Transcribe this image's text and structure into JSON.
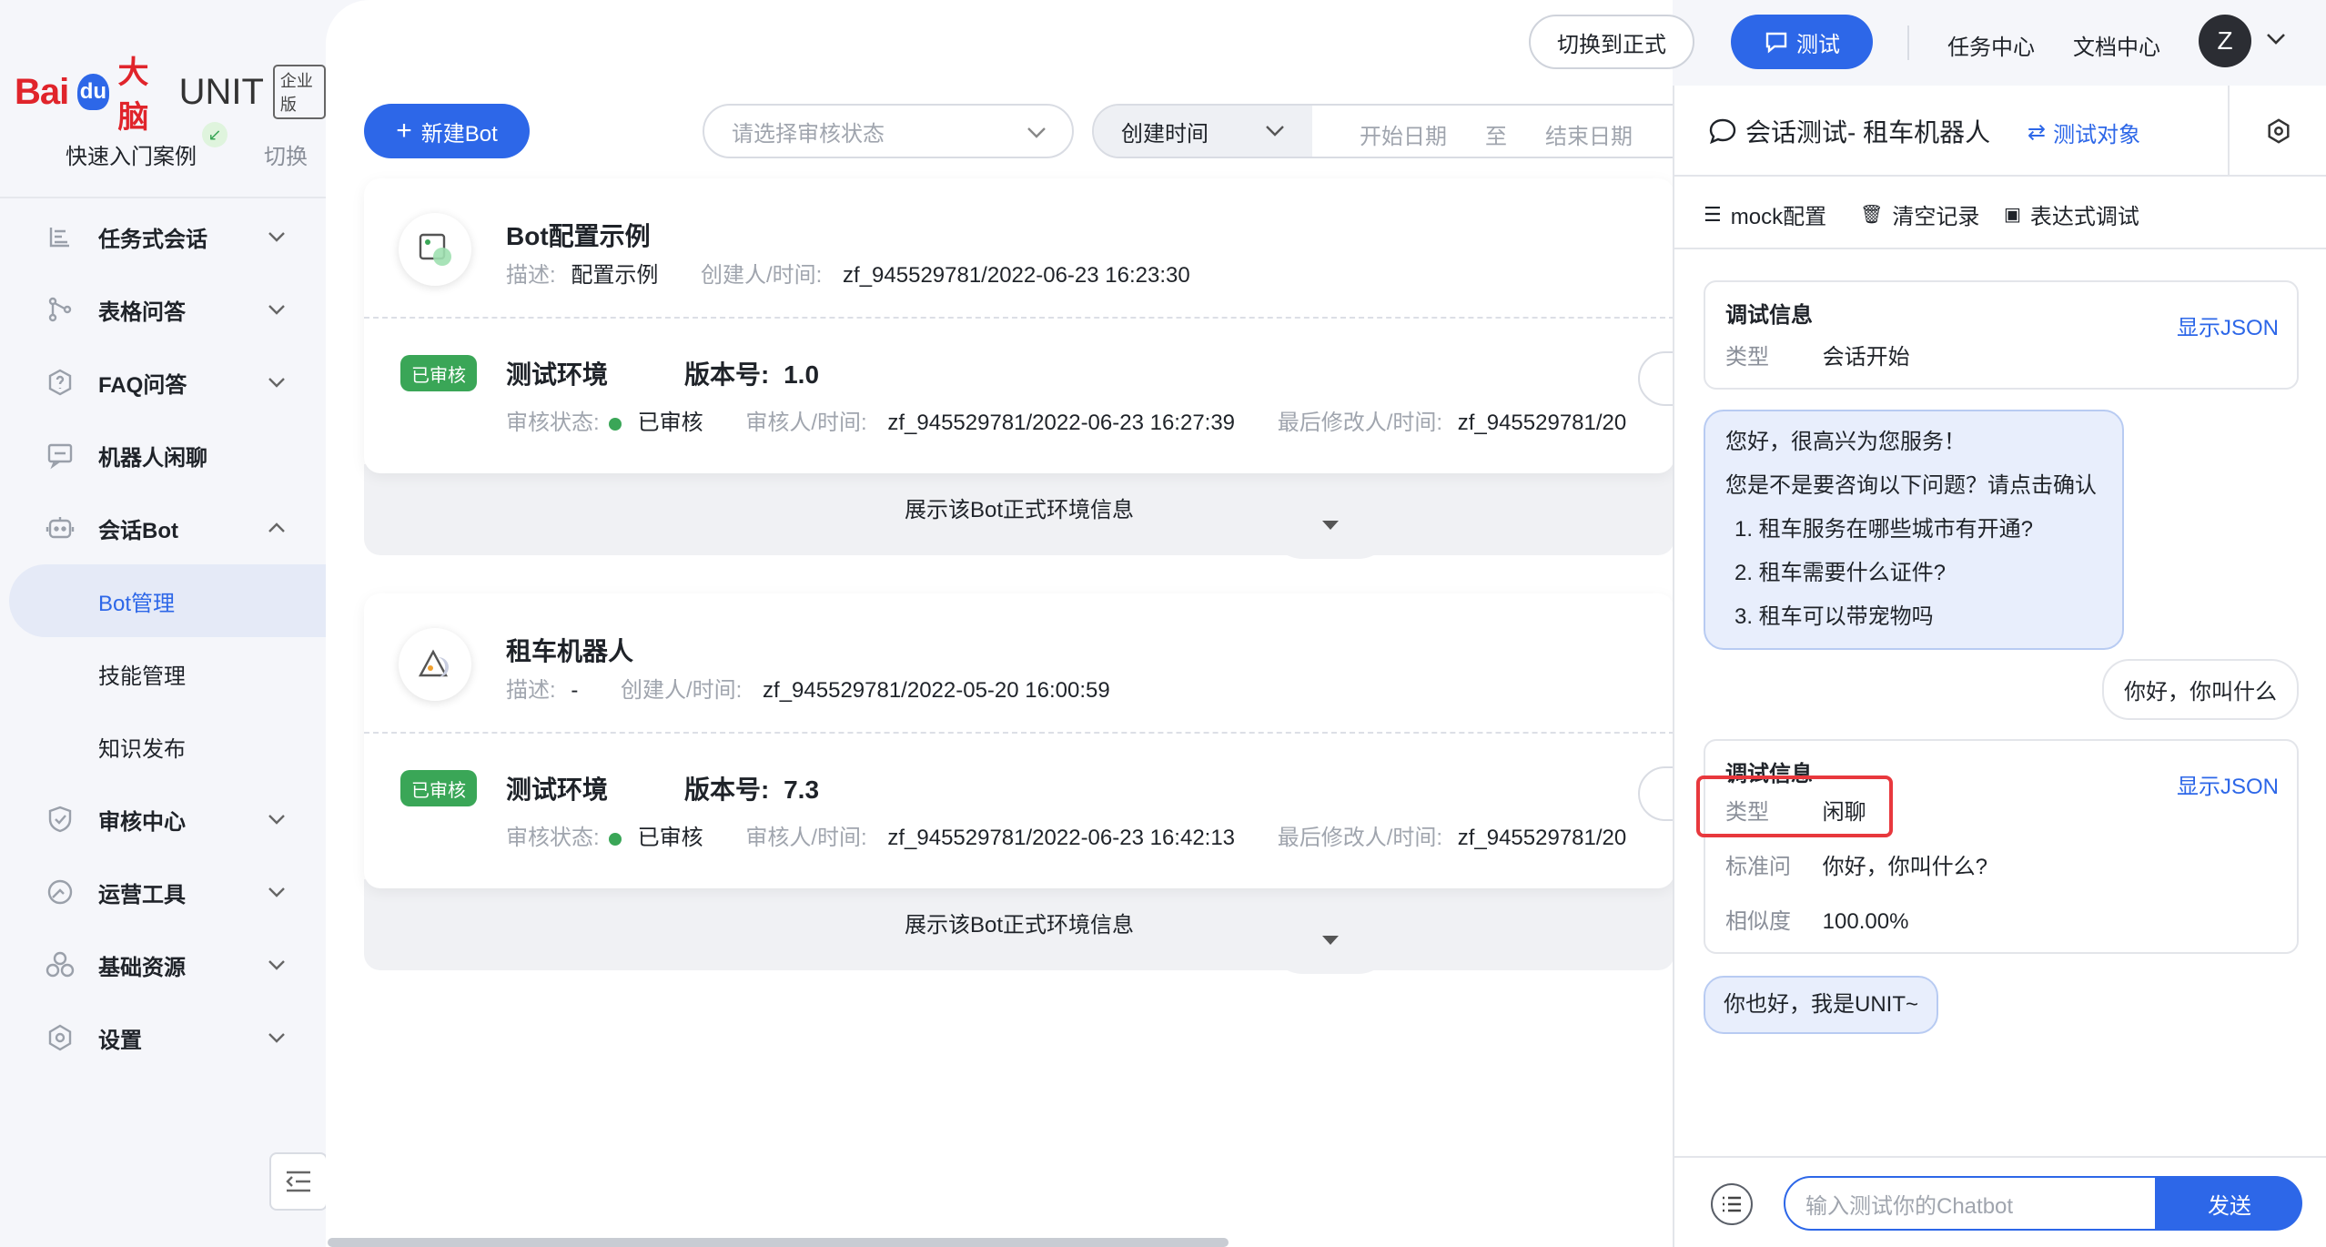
{
  "brand": {
    "bai": "Bai",
    "du": "du",
    "dana": "大脑",
    "product": "UNIT",
    "edition": "企业版"
  },
  "sidebar": {
    "quick_start": "快速入门案例",
    "switch": "切换",
    "items": [
      {
        "label": "任务式会话",
        "icon": "flow-icon",
        "expanded": false
      },
      {
        "label": "表格问答",
        "icon": "branch-icon",
        "expanded": false
      },
      {
        "label": "FAQ问答",
        "icon": "question-icon",
        "expanded": false
      },
      {
        "label": "机器人闲聊",
        "icon": "chat-box-icon",
        "expanded": null
      },
      {
        "label": "会话Bot",
        "icon": "bot-icon",
        "expanded": true
      },
      {
        "label": "审核中心",
        "icon": "shield-check-icon",
        "expanded": false
      },
      {
        "label": "运营工具",
        "icon": "gauge-icon",
        "expanded": false
      },
      {
        "label": "基础资源",
        "icon": "cubes-icon",
        "expanded": false
      },
      {
        "label": "设置",
        "icon": "gear-icon",
        "expanded": false
      }
    ],
    "sub_items": [
      "Bot管理",
      "技能管理",
      "知识发布"
    ],
    "active_sub": "Bot管理"
  },
  "topbar": {
    "switch_formal": "切换到正式",
    "test": "测试",
    "task_center": "任务中心",
    "doc_center": "文档中心",
    "avatar": "Z"
  },
  "toolbar": {
    "new_bot": "新建Bot",
    "status_placeholder": "请选择审核状态",
    "date_type": "创建时间",
    "start_date": "开始日期",
    "to": "至",
    "end_date": "结束日期"
  },
  "bots": [
    {
      "name": "Bot配置示例",
      "desc_label": "描述:",
      "desc": "配置示例",
      "creator_label": "创建人/时间:",
      "creator": "zf_945529781/2022-06-23 16:23:30",
      "env": {
        "tag": "已审核",
        "name": "测试环境",
        "version_label": "版本号:",
        "version": "1.0",
        "status_label": "审核状态:",
        "status": "已审核",
        "reviewer_label": "审核人/时间:",
        "reviewer": "zf_945529781/2022-06-23 16:27:39",
        "modifier_label": "最后修改人/时间:",
        "modifier": "zf_945529781/20"
      },
      "expand": "展示该Bot正式环境信息"
    },
    {
      "name": "租车机器人",
      "desc_label": "描述:",
      "desc": "-",
      "creator_label": "创建人/时间:",
      "creator": "zf_945529781/2022-05-20 16:00:59",
      "env": {
        "tag": "已审核",
        "name": "测试环境",
        "version_label": "版本号:",
        "version": "7.3",
        "status_label": "审核状态:",
        "status": "已审核",
        "reviewer_label": "审核人/时间:",
        "reviewer": "zf_945529781/2022-06-23 16:42:13",
        "modifier_label": "最后修改人/时间:",
        "modifier": "zf_945529781/20"
      },
      "expand": "展示该Bot正式环境信息"
    }
  ],
  "chat": {
    "title": "会话测试- 租车机器人",
    "target": "测试对象",
    "tools": {
      "mock": "mock配置",
      "clear": "清空记录",
      "expr": "表达式调试"
    },
    "debug1": {
      "title": "调试信息",
      "show_json": "显示JSON",
      "type_k": "类型",
      "type_v": "会话开始"
    },
    "bot_msg1": {
      "line1": "您好，很高兴为您服务！",
      "line2": "您是不是要咨询以下问题？请点击确认",
      "opt1": "1. 租车服务在哪些城市有开通?",
      "opt2": "2. 租车需要什么证件?",
      "opt3": "3. 租车可以带宠物吗"
    },
    "user_msg": "你好，你叫什么",
    "debug2": {
      "title": "调试信息",
      "show_json": "显示JSON",
      "type_k": "类型",
      "type_v": "闲聊",
      "std_k": "标准问",
      "std_v": "你好，你叫什么?",
      "sim_k": "相似度",
      "sim_v": "100.00%"
    },
    "bot_msg2": "你也好，我是UNIT~",
    "input_placeholder": "输入测试你的Chatbot",
    "send": "发送"
  },
  "colors": {
    "primary": "#2d67e8",
    "success": "#3aa657",
    "brand_red": "#e0242b",
    "highlight": "#e8383d"
  }
}
